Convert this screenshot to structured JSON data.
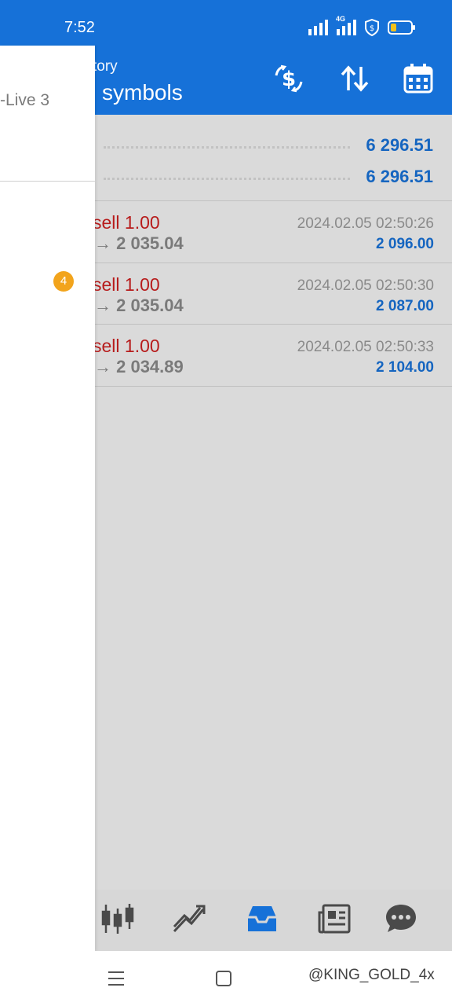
{
  "status_bar": {
    "time": "7:52",
    "network": "4G"
  },
  "app_bar": {
    "subtitle": "tory",
    "title": "symbols",
    "actions": [
      "currency-exchange-icon",
      "sort-icon",
      "calendar-icon"
    ]
  },
  "summary": [
    {
      "value": "6 296.51"
    },
    {
      "value": "6 296.51"
    }
  ],
  "trades": [
    {
      "type": "sell 1.00",
      "price": "→ 2 035.04",
      "time": "2024.02.05 02:50:26",
      "profit": "2 096.00"
    },
    {
      "type": "sell 1.00",
      "price": "→ 2 035.04",
      "time": "2024.02.05 02:50:30",
      "profit": "2 087.00"
    },
    {
      "type": "sell 1.00",
      "price": "→ 2 034.89",
      "time": "2024.02.05 02:50:33",
      "profit": "2 104.00"
    }
  ],
  "drawer": {
    "account": "-Live 3",
    "badge": "4"
  },
  "bottom_nav": {
    "items": [
      "quotes-icon",
      "trade-icon",
      "history-icon",
      "news-icon",
      "chat-icon"
    ],
    "active": "history-icon"
  },
  "watermark": "@KING_GOLD_4x",
  "colors": {
    "accent": "#1671d8",
    "sell": "#b71c1c",
    "profit": "#1565c0",
    "badge": "#f2a41c"
  }
}
